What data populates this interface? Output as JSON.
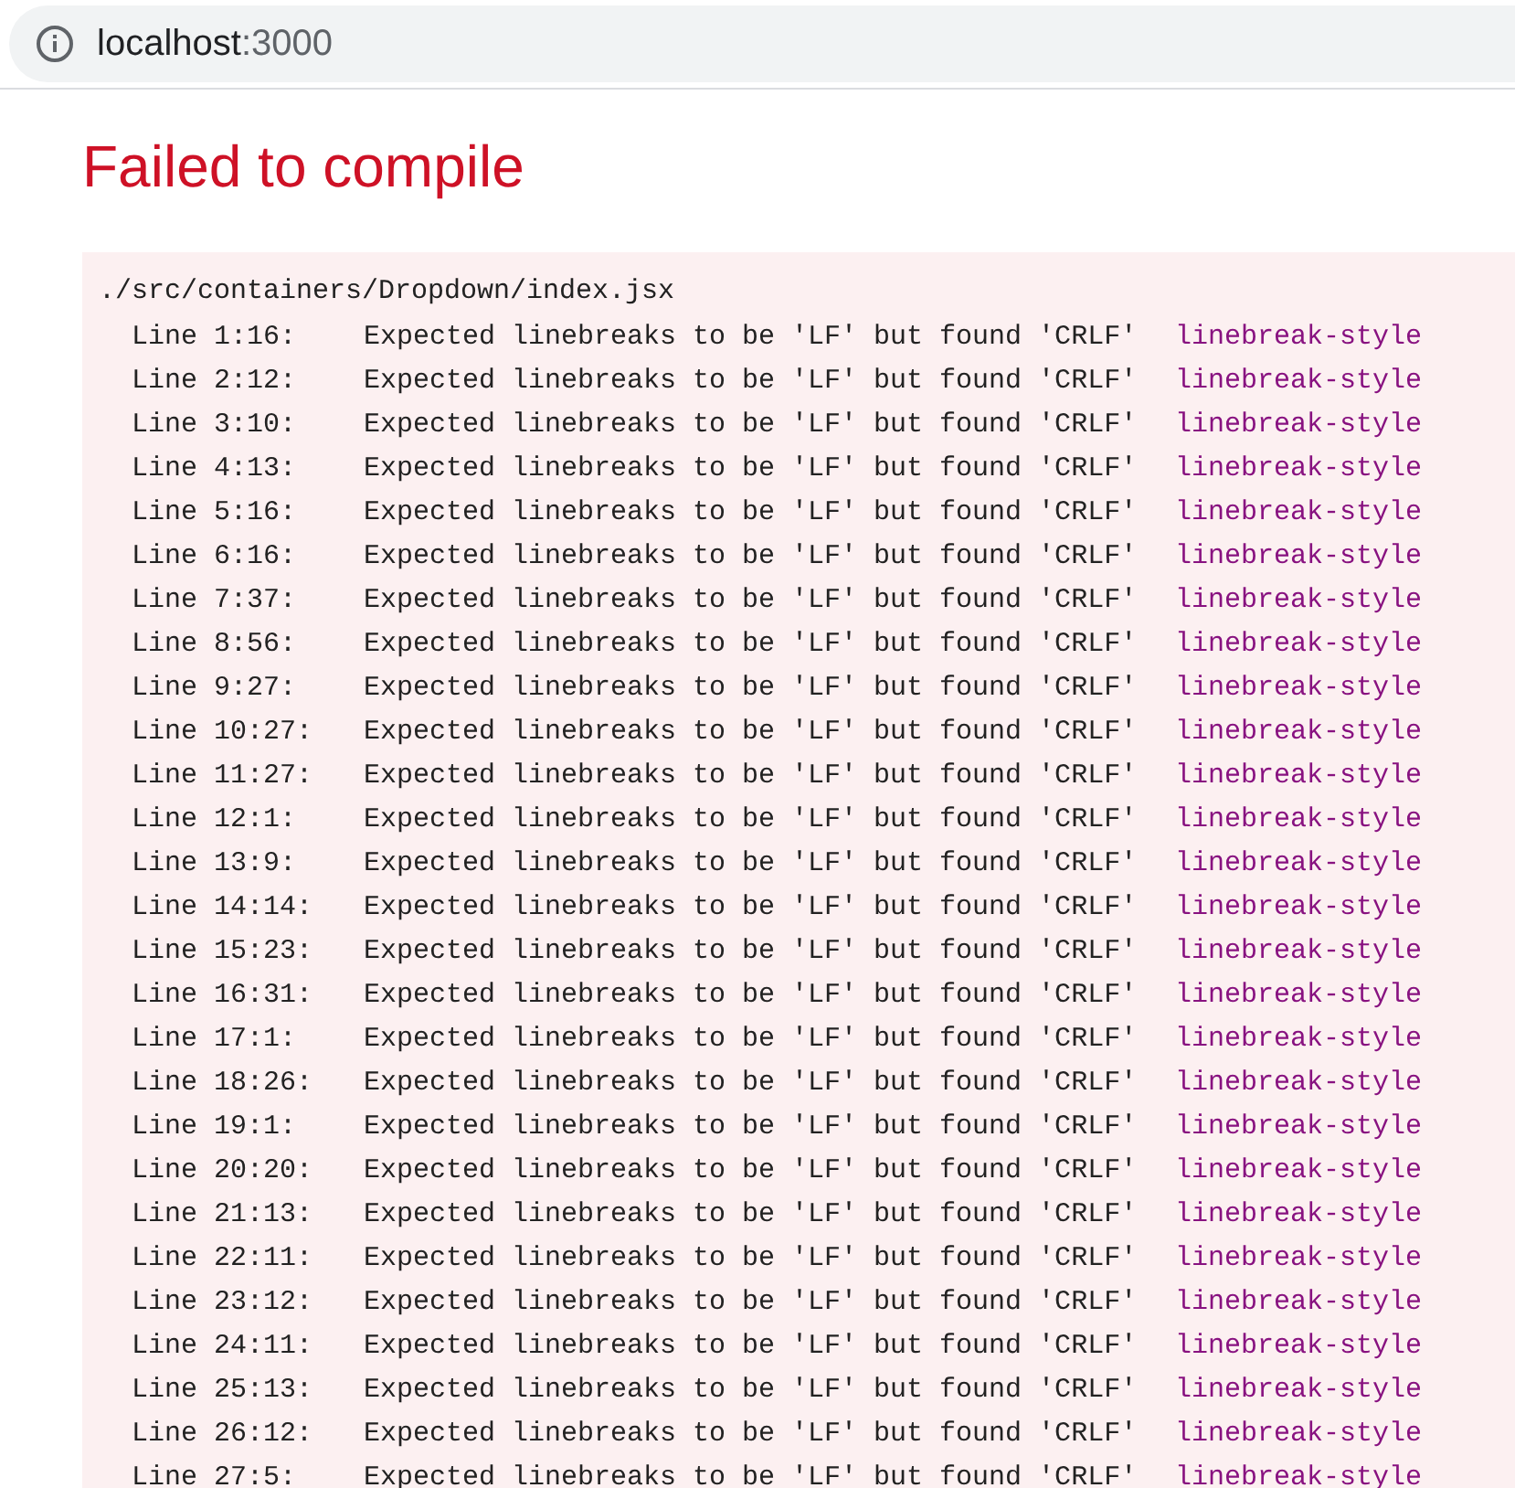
{
  "address_bar": {
    "host": "localhost",
    "port": ":3000"
  },
  "title": "Failed to compile",
  "error": {
    "file": "./src/containers/Dropdown/index.jsx",
    "lines": [
      {
        "location": "Line 1:16:",
        "message": "Expected linebreaks to be 'LF' but found 'CRLF'",
        "rule": "linebreak-style"
      },
      {
        "location": "Line 2:12:",
        "message": "Expected linebreaks to be 'LF' but found 'CRLF'",
        "rule": "linebreak-style"
      },
      {
        "location": "Line 3:10:",
        "message": "Expected linebreaks to be 'LF' but found 'CRLF'",
        "rule": "linebreak-style"
      },
      {
        "location": "Line 4:13:",
        "message": "Expected linebreaks to be 'LF' but found 'CRLF'",
        "rule": "linebreak-style"
      },
      {
        "location": "Line 5:16:",
        "message": "Expected linebreaks to be 'LF' but found 'CRLF'",
        "rule": "linebreak-style"
      },
      {
        "location": "Line 6:16:",
        "message": "Expected linebreaks to be 'LF' but found 'CRLF'",
        "rule": "linebreak-style"
      },
      {
        "location": "Line 7:37:",
        "message": "Expected linebreaks to be 'LF' but found 'CRLF'",
        "rule": "linebreak-style"
      },
      {
        "location": "Line 8:56:",
        "message": "Expected linebreaks to be 'LF' but found 'CRLF'",
        "rule": "linebreak-style"
      },
      {
        "location": "Line 9:27:",
        "message": "Expected linebreaks to be 'LF' but found 'CRLF'",
        "rule": "linebreak-style"
      },
      {
        "location": "Line 10:27:",
        "message": "Expected linebreaks to be 'LF' but found 'CRLF'",
        "rule": "linebreak-style"
      },
      {
        "location": "Line 11:27:",
        "message": "Expected linebreaks to be 'LF' but found 'CRLF'",
        "rule": "linebreak-style"
      },
      {
        "location": "Line 12:1:",
        "message": "Expected linebreaks to be 'LF' but found 'CRLF'",
        "rule": "linebreak-style"
      },
      {
        "location": "Line 13:9:",
        "message": "Expected linebreaks to be 'LF' but found 'CRLF'",
        "rule": "linebreak-style"
      },
      {
        "location": "Line 14:14:",
        "message": "Expected linebreaks to be 'LF' but found 'CRLF'",
        "rule": "linebreak-style"
      },
      {
        "location": "Line 15:23:",
        "message": "Expected linebreaks to be 'LF' but found 'CRLF'",
        "rule": "linebreak-style"
      },
      {
        "location": "Line 16:31:",
        "message": "Expected linebreaks to be 'LF' but found 'CRLF'",
        "rule": "linebreak-style"
      },
      {
        "location": "Line 17:1:",
        "message": "Expected linebreaks to be 'LF' but found 'CRLF'",
        "rule": "linebreak-style"
      },
      {
        "location": "Line 18:26:",
        "message": "Expected linebreaks to be 'LF' but found 'CRLF'",
        "rule": "linebreak-style"
      },
      {
        "location": "Line 19:1:",
        "message": "Expected linebreaks to be 'LF' but found 'CRLF'",
        "rule": "linebreak-style"
      },
      {
        "location": "Line 20:20:",
        "message": "Expected linebreaks to be 'LF' but found 'CRLF'",
        "rule": "linebreak-style"
      },
      {
        "location": "Line 21:13:",
        "message": "Expected linebreaks to be 'LF' but found 'CRLF'",
        "rule": "linebreak-style"
      },
      {
        "location": "Line 22:11:",
        "message": "Expected linebreaks to be 'LF' but found 'CRLF'",
        "rule": "linebreak-style"
      },
      {
        "location": "Line 23:12:",
        "message": "Expected linebreaks to be 'LF' but found 'CRLF'",
        "rule": "linebreak-style"
      },
      {
        "location": "Line 24:11:",
        "message": "Expected linebreaks to be 'LF' but found 'CRLF'",
        "rule": "linebreak-style"
      },
      {
        "location": "Line 25:13:",
        "message": "Expected linebreaks to be 'LF' but found 'CRLF'",
        "rule": "linebreak-style"
      },
      {
        "location": "Line 26:12:",
        "message": "Expected linebreaks to be 'LF' but found 'CRLF'",
        "rule": "linebreak-style"
      },
      {
        "location": "Line 27:5:",
        "message": "Expected linebreaks to be 'LF' but found 'CRLF'",
        "rule": "linebreak-style"
      }
    ]
  }
}
